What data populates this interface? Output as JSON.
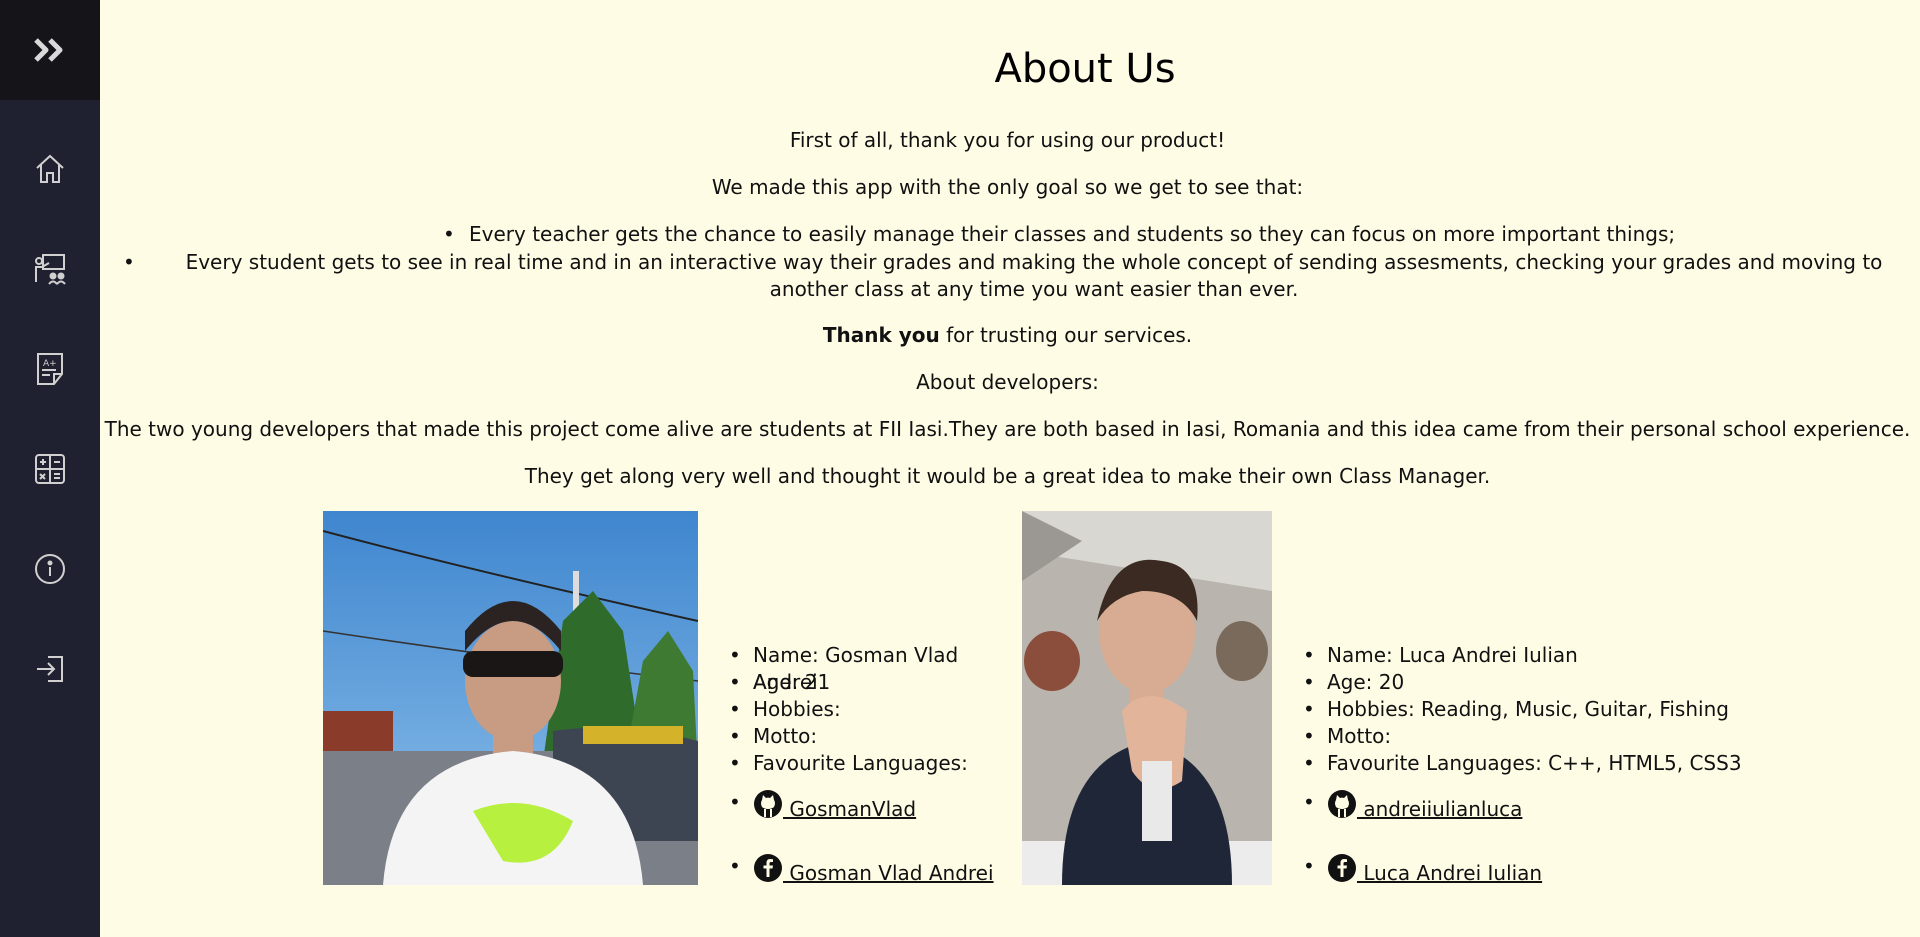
{
  "sidebar": {
    "toggle_icon": "double-chevron-right-icon",
    "items": [
      {
        "icon": "home-icon"
      },
      {
        "icon": "teacher-classroom-icon"
      },
      {
        "icon": "grade-document-icon"
      },
      {
        "icon": "calculator-icon"
      },
      {
        "icon": "info-icon"
      },
      {
        "icon": "logout-icon"
      }
    ]
  },
  "main": {
    "title": "About Us",
    "intro1": "First of all, thank you for using our product!",
    "intro2": "We made this app with the only goal so we get to see that:",
    "goals": [
      "Every teacher gets the chance to easily manage their classes and students so they can focus on more important things;",
      "Every student gets to see in real time and in an interactive way their grades and making the whole concept of sending assesments, checking your grades and moving to another class at any time you want easier than ever."
    ],
    "thanks_bold": "Thank you",
    "thanks_rest": " for trusting our services.",
    "about_devs": "About developers:",
    "devs_text": "The two young developers that made this project come alive are students at FII Iasi.They are both based in Iasi, Romania and this idea came from their personal school experience.",
    "devs_text2": "They get along very well and thought it would be a great idea to make their own Class Manager."
  },
  "developers": [
    {
      "name": "Name: Gosman Vlad Andrei",
      "age": "Age: 21",
      "hobbies": "Hobbies:",
      "motto": "Motto:",
      "languages": "Favourite Languages:",
      "github": " GosmanVlad",
      "facebook": " Gosman Vlad Andrei"
    },
    {
      "name": "Name: Luca Andrei Iulian",
      "age": "Age: 20",
      "hobbies": "Hobbies: Reading, Music, Guitar, Fishing",
      "motto": "Motto:",
      "languages": "Favourite Languages: C++, HTML5, CSS3",
      "github": " andreiiulianluca",
      "facebook": " Luca Andrei Iulian"
    }
  ]
}
